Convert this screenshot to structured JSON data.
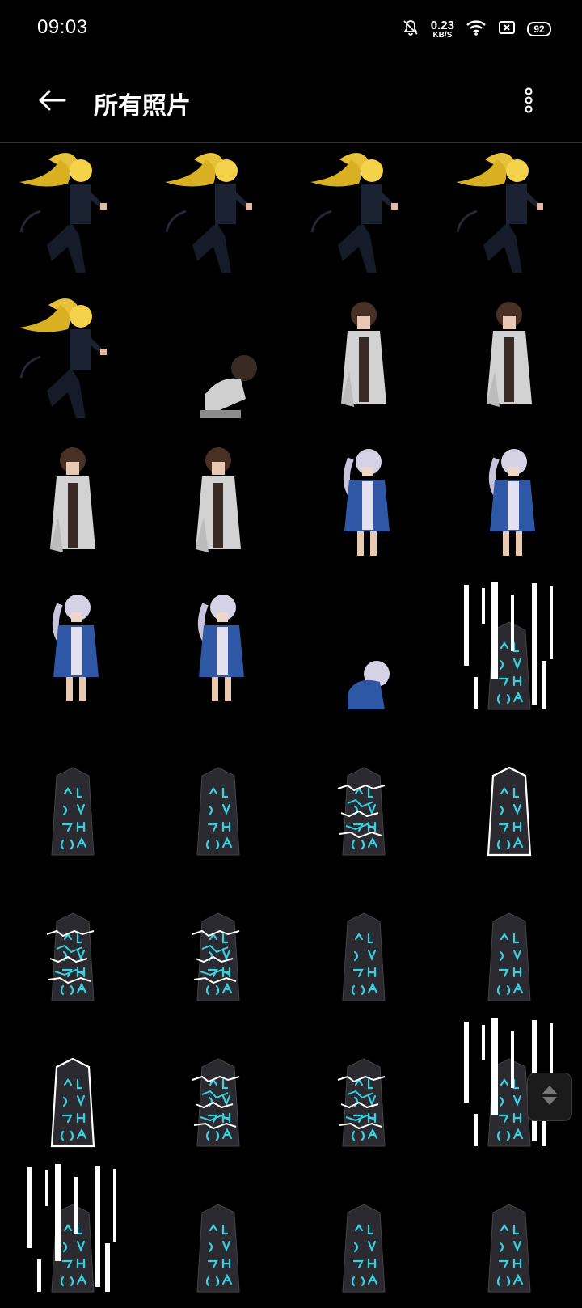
{
  "status": {
    "time": "09:03",
    "net_speed": "0.23",
    "net_unit": "KB/S",
    "battery": "92"
  },
  "header": {
    "title": "所有照片",
    "back_icon": "arrow-left-icon",
    "more_icon": "more-vert-icon"
  },
  "colors": {
    "background": "#000000",
    "text": "#ffffff",
    "accent": "#39d0e0"
  },
  "grid": {
    "columns": 4,
    "items": [
      "blonde-ponytail-runner-sprite",
      "blonde-ponytail-runner-sprite",
      "blonde-ponytail-runner-sprite",
      "blonde-ponytail-runner-sprite",
      "blonde-ponytail-runner-sprite",
      "brown-haired-crouching-sprite",
      "brown-haired-white-coat-sprite",
      "brown-haired-white-coat-sprite",
      "brown-haired-white-coat-sprite",
      "brown-haired-white-coat-sprite",
      "silver-haired-blue-jacket-sprite",
      "silver-haired-blue-jacket-sprite",
      "silver-haired-blue-jacket-sprite",
      "silver-haired-blue-jacket-sprite",
      "silver-haired-crouching-sprite",
      "obelisk-glitch-sprite",
      "rune-obelisk-sprite",
      "rune-obelisk-sprite",
      "obelisk-lightning-sprite",
      "obelisk-outline-sprite",
      "obelisk-lightning-sprite",
      "obelisk-lightning-sprite",
      "rune-obelisk-sprite",
      "rune-obelisk-sprite",
      "obelisk-outline-sprite",
      "obelisk-lightning-sprite",
      "obelisk-lightning-sprite",
      "obelisk-glitch-sprite",
      "obelisk-glitch-sprite",
      "rune-obelisk-sprite",
      "rune-obelisk-sprite",
      "rune-obelisk-sprite"
    ]
  },
  "scroll_handle_icon": "fast-scroll-icon"
}
